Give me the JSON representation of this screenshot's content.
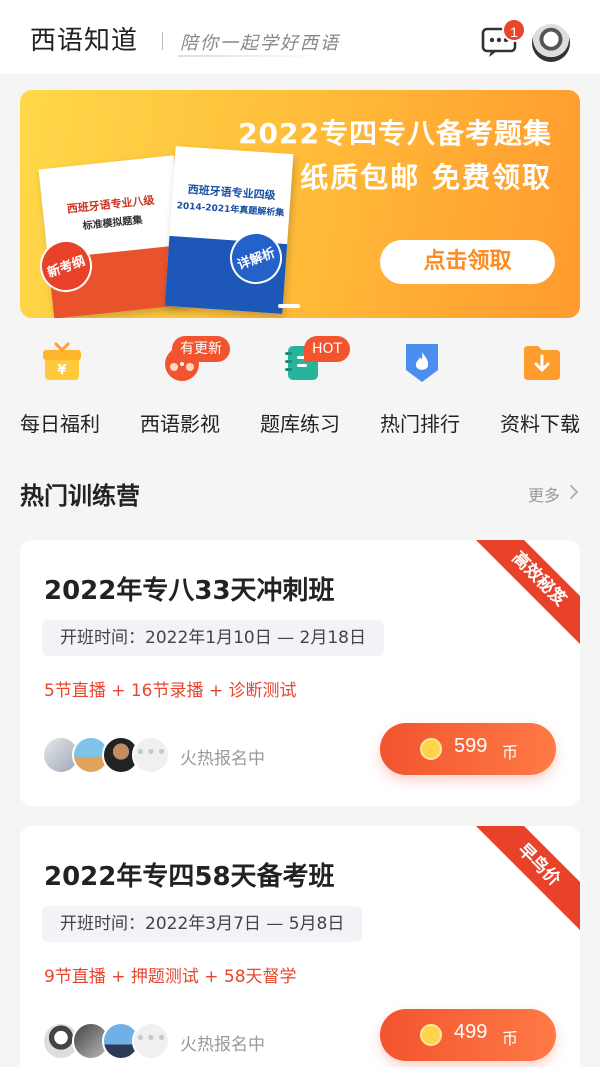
{
  "header": {
    "app_title": "西语知道",
    "slogan": "陪你一起学好西语",
    "message_badge": "1"
  },
  "banner": {
    "title_line1": "2022专四专八备考题集",
    "title_line2": "纸质包邮 免费领取",
    "cta": "点击领取",
    "book_a_title": "西班牙语专业八级",
    "book_a_subtitle": "标准模拟题集",
    "book_a_seal": "新考纲",
    "book_b_title": "西班牙语专业四级",
    "book_b_subtitle": "2014-2021年真题解析集",
    "book_b_seal": "详解析"
  },
  "quicknav": [
    {
      "label": "每日福利",
      "icon": "gift-icon",
      "badge": ""
    },
    {
      "label": "西语影视",
      "icon": "film-reel-icon",
      "badge": "有更新"
    },
    {
      "label": "题库练习",
      "icon": "notebook-icon",
      "badge": "HOT"
    },
    {
      "label": "热门排行",
      "icon": "flame-shield-icon",
      "badge": ""
    },
    {
      "label": "资料下载",
      "icon": "download-folder-icon",
      "badge": ""
    }
  ],
  "section": {
    "title": "热门训练营",
    "more": "更多"
  },
  "courses": [
    {
      "ribbon": "高效秘笈",
      "title": "2022年专八33天冲刺班",
      "date": "开班时间：2022年1月10日 — 2月18日",
      "features": "5节直播 + 16节录播 + 诊断测试",
      "hot_text": "火热报名中",
      "price": "599",
      "unit": "币"
    },
    {
      "ribbon": "早鸟价",
      "title": "2022年专四58天备考班",
      "date": "开班时间：2022年3月7日 — 5月8日",
      "features": "9节直播 + 押题测试 + 58天督学",
      "hot_text": "火热报名中",
      "price": "499",
      "unit": "币"
    }
  ],
  "colors": {
    "accent": "#f2542f",
    "banner_start": "#ffd84a",
    "banner_end": "#ff9a2e"
  }
}
